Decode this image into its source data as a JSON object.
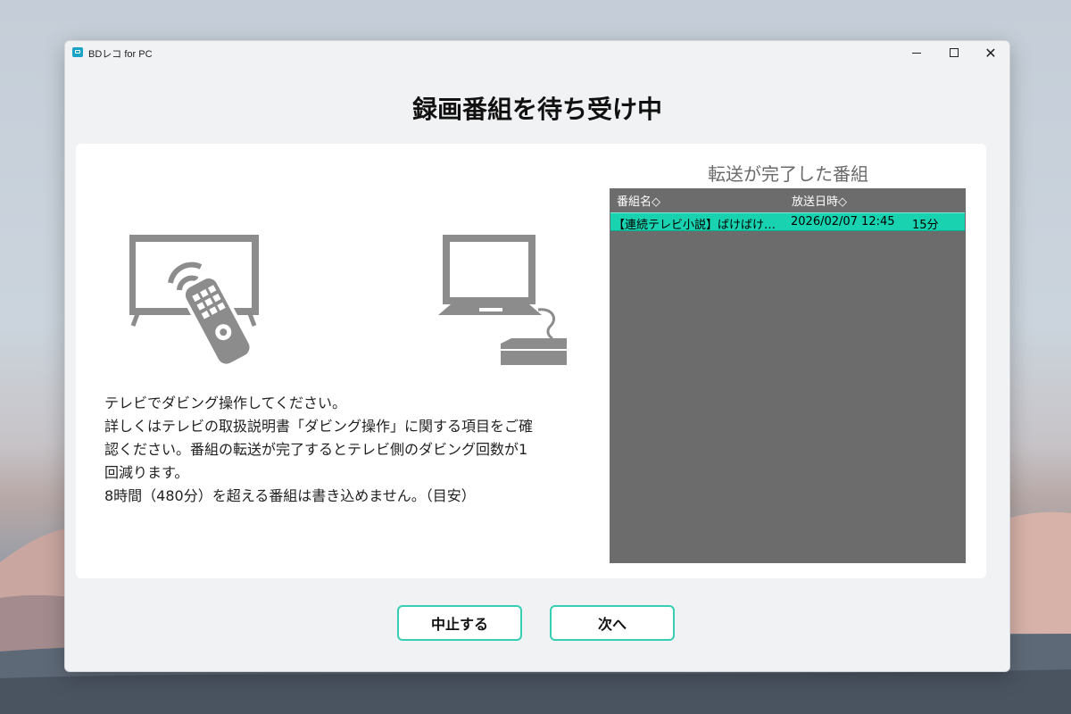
{
  "window": {
    "app_title": "BDレコ for PC",
    "heading": "録画番組を待ち受け中"
  },
  "instructions": {
    "lines": [
      "テレビでダビング操作してください。",
      "詳しくはテレビの取扱説明書「ダビング操作」に関する項目をご確",
      "認ください。番組の転送が完了するとテレビ側のダビング回数が1",
      "回減ります。",
      "8時間（480分）を超える番組は書き込めません。（目安）"
    ]
  },
  "completed": {
    "title": "転送が完了した番組",
    "columns": [
      "番組名◇",
      "放送日時◇"
    ],
    "rows": [
      {
        "name": "【連続テレビ小説】ばけばけ…",
        "datetime": "2026/02/07 12:45",
        "duration": "15分"
      }
    ]
  },
  "buttons": {
    "cancel": "中止する",
    "next": "次へ"
  },
  "icons": [
    "tv-with-remote-icon",
    "laptop-with-drive-icon",
    "minimize-icon",
    "maximize-icon",
    "close-icon"
  ],
  "colors": {
    "accent": "#36cfb4",
    "selected_row": "#19d2b0",
    "list_bg": "#6c6c6c"
  }
}
